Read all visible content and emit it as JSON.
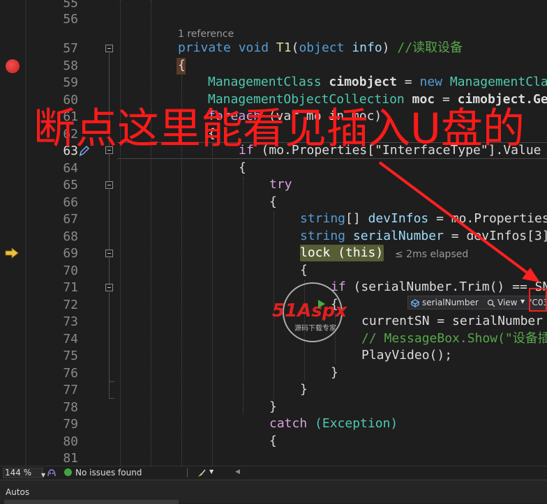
{
  "editor": {
    "lines": [
      {
        "num": "55"
      },
      {
        "num": "56"
      },
      {
        "num": "57"
      },
      {
        "num": "58"
      },
      {
        "num": "59"
      },
      {
        "num": "60"
      },
      {
        "num": "61"
      },
      {
        "num": "62"
      },
      {
        "num": "63"
      },
      {
        "num": "64"
      },
      {
        "num": "65"
      },
      {
        "num": "66"
      },
      {
        "num": "67"
      },
      {
        "num": "68"
      },
      {
        "num": "69"
      },
      {
        "num": "70"
      },
      {
        "num": "71"
      },
      {
        "num": "72"
      },
      {
        "num": "73"
      },
      {
        "num": "74"
      },
      {
        "num": "75"
      },
      {
        "num": "76"
      },
      {
        "num": "77"
      },
      {
        "num": "78"
      },
      {
        "num": "79"
      },
      {
        "num": "80"
      },
      {
        "num": "81"
      }
    ],
    "codelens": "1 reference",
    "elapsed": "≤ 2ms elapsed",
    "current_line": "63"
  },
  "code": {
    "l57_private": "private",
    "l57_void": "void",
    "l57_name": "T1",
    "l57_paren_open": "(",
    "l57_object": "object",
    "l57_info": "info",
    "l57_paren_close": ")",
    "l57_comment": "//读取设备",
    "l58_brace": "{",
    "l59_type": "ManagementClass",
    "l59_var": "cimobject",
    "l59_eq": "=",
    "l59_new": "new",
    "l59_type2": "ManagementCla",
    "l60_type": "ManagementObjectCollection",
    "l60_var": "moc",
    "l60_eq": "=",
    "l60_rhs": "cimobject.Ge",
    "l61_foreach": "foreach",
    "l61_rest": "(var mo in moc)",
    "l62_brace": "{",
    "l63_if": "if",
    "l63_rest": "(mo.Properties[\"InterfaceType\"].Value",
    "l64_brace": "{",
    "l65_try": "try",
    "l66_brace": "{",
    "l67_string": "string",
    "l67_brackets": "[]",
    "l67_var": "devInfos",
    "l67_rest": "= mo.Properties",
    "l68_string": "string",
    "l68_var": "serialNumber",
    "l68_rest": "= devInfos[3]",
    "l69_lock": "lock (this)",
    "l70_brace": "{",
    "l71_if": "if",
    "l71_rest": "(serialNumber.Trim() == SN",
    "l72_brace": "{",
    "l73_code": "currentSN = serialNumber",
    "l74_comment": "// MessageBox.Show(\"设备插",
    "l75_code": "PlayVideo();",
    "l76_brace": "}",
    "l77_brace": "}",
    "l78_brace": "}",
    "l79_catch": "catch",
    "l79_rest": "(Exception)",
    "l80_brace": "{"
  },
  "annotation": {
    "text": "断点这里能看见插入U盘的",
    "color": "#ff1a1a"
  },
  "datatip": {
    "name": "serialNumber",
    "view": "View",
    "value": "\"C03"
  },
  "watermark": {
    "brand": "51Aspx",
    "tagline": "源码下载专家"
  },
  "statusbar": {
    "zoom": "144 %",
    "issues": "No issues found"
  },
  "autos": {
    "title": "Autos"
  },
  "colors": {
    "background": "#1e1e1e",
    "keyword": "#569cd6",
    "type": "#4ec9b0",
    "breakpoint": "#e51400",
    "exec_arrow": "#f0c040"
  },
  "icons": [
    "breakpoint-icon",
    "execution-arrow-icon",
    "pencil-icon",
    "search-icon",
    "chevron-down-icon",
    "check-circle-icon",
    "brush-icon"
  ]
}
